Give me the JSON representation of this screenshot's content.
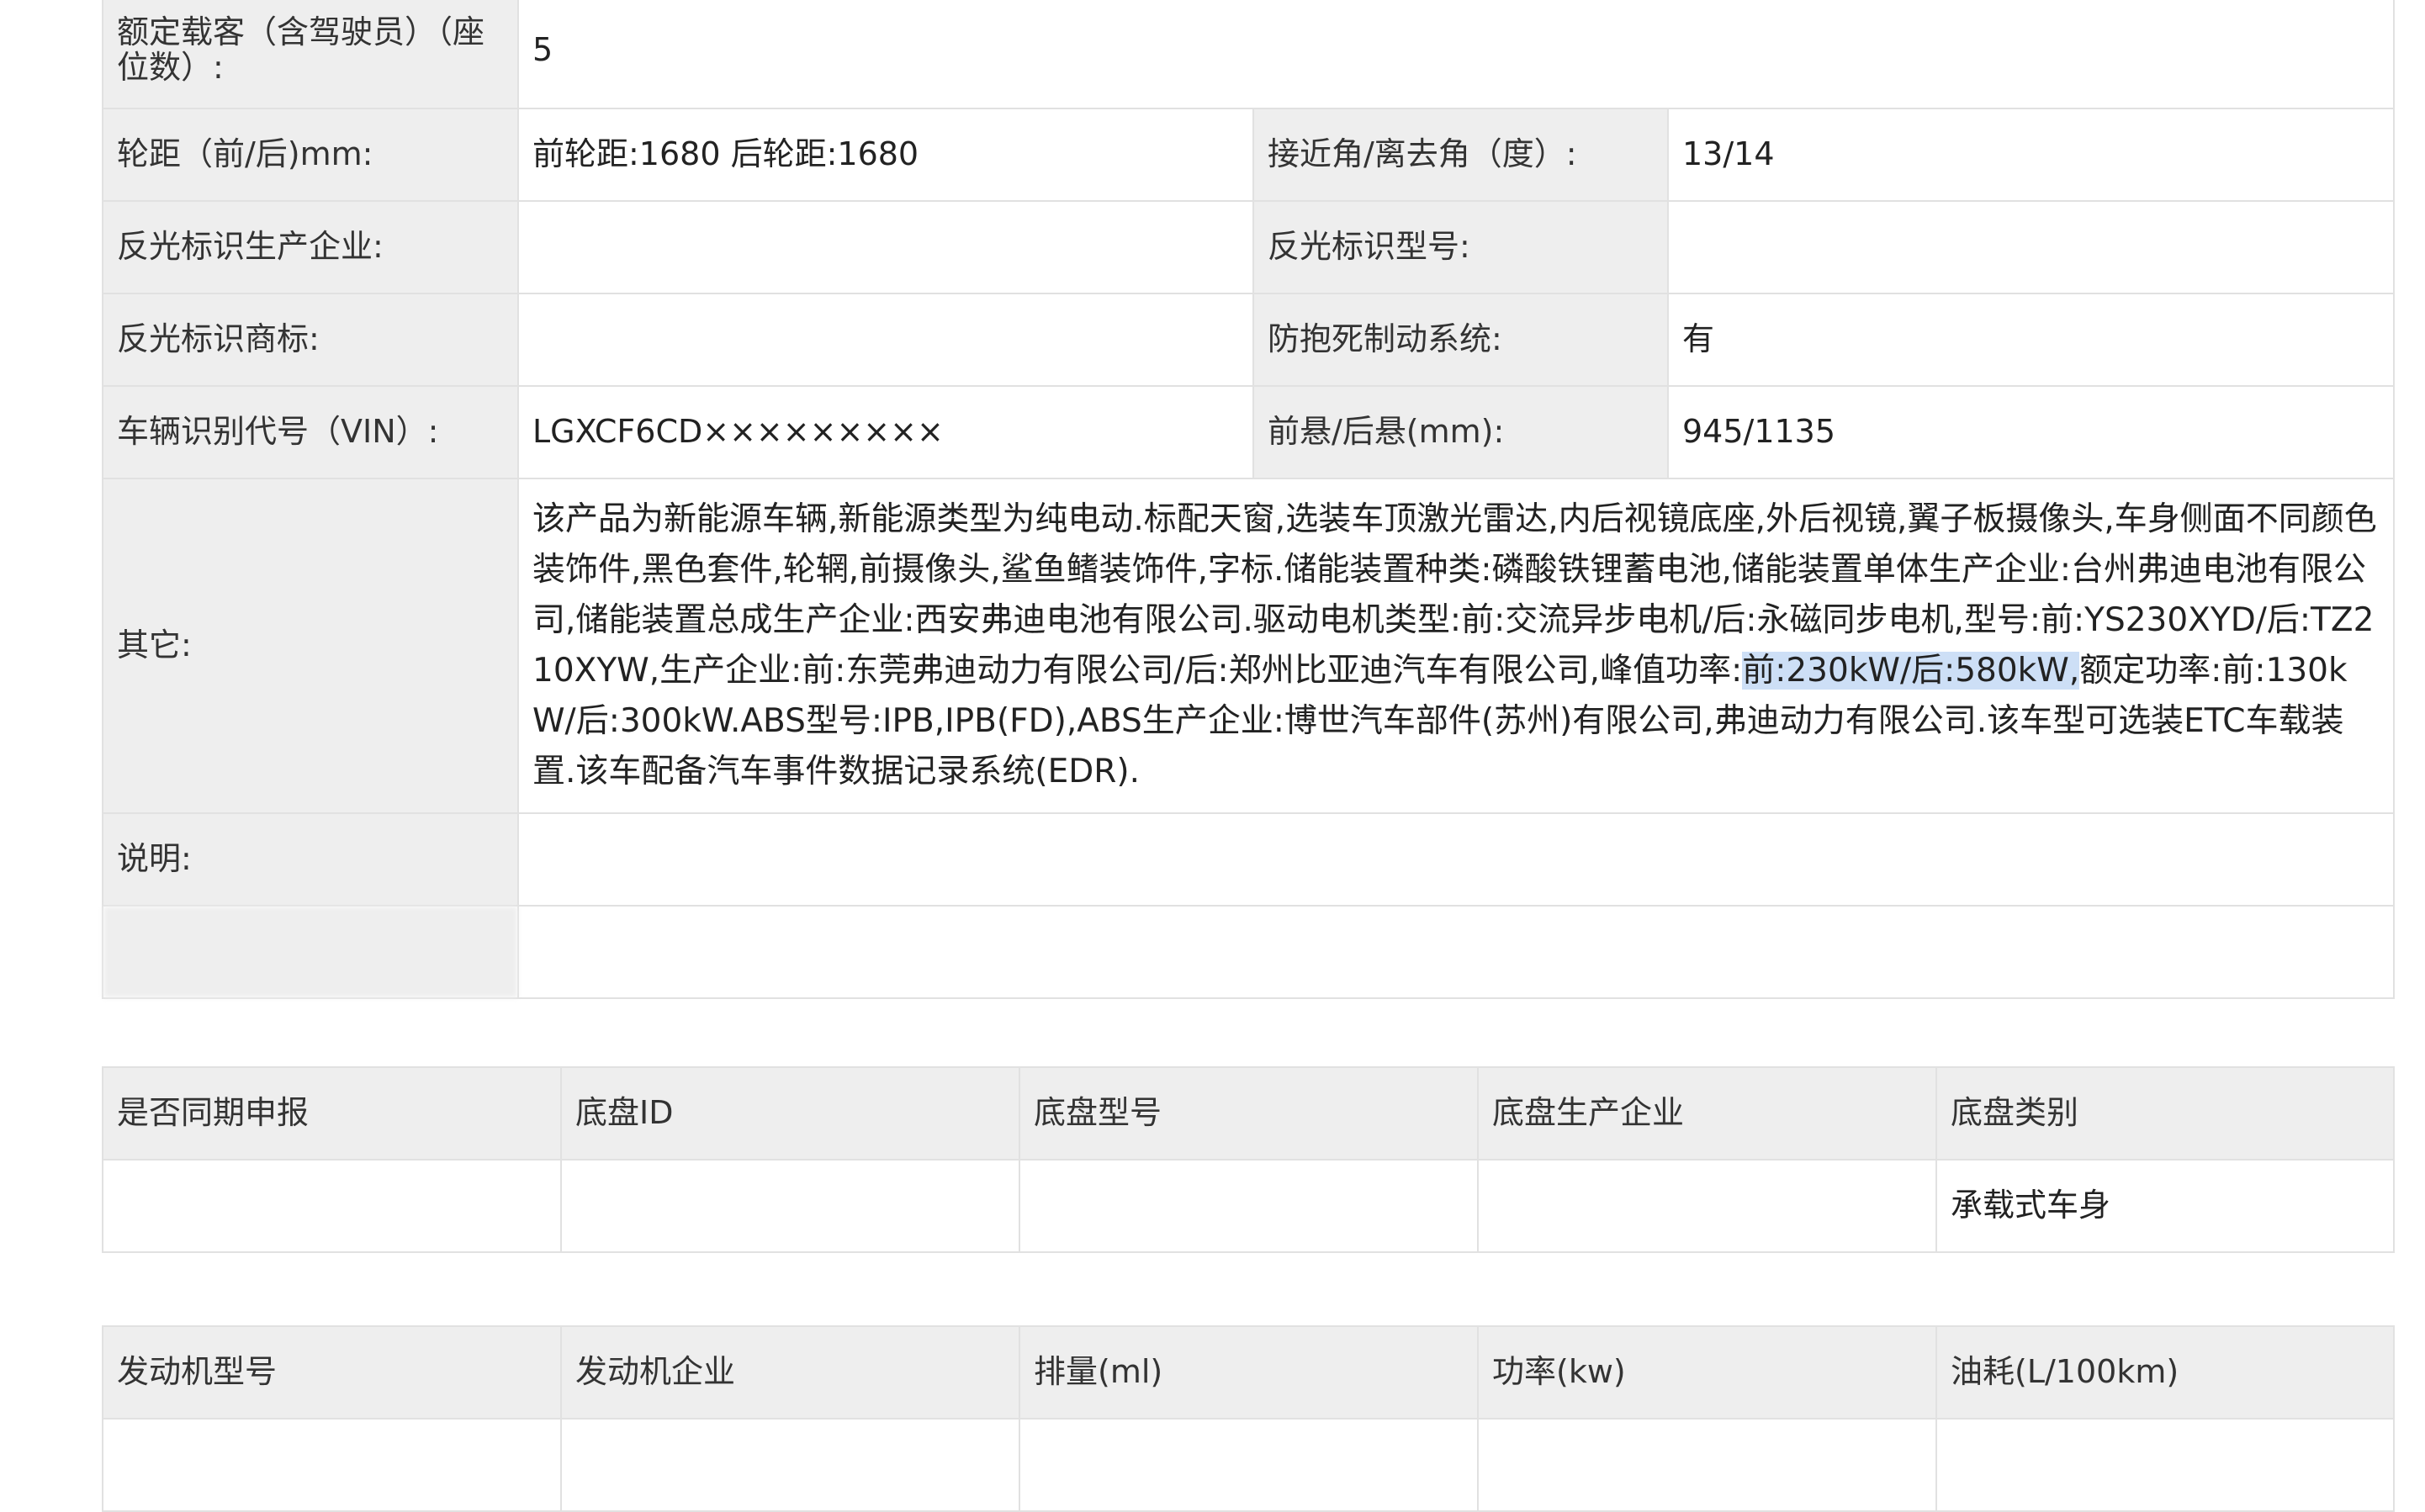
{
  "params": {
    "seats_label": "额定载客（含驾驶员）（座位数）:",
    "seats_value": "5",
    "track_label": "轮距（前/后)mm:",
    "track_value": "前轮距:1680 后轮距:1680",
    "angle_label": "接近角/离去角（度）:",
    "angle_value": "13/14",
    "reflector_maker_label": "反光标识生产企业:",
    "reflector_maker_value": "",
    "reflector_model_label": "反光标识型号:",
    "reflector_model_value": "",
    "reflector_brand_label": "反光标识商标:",
    "reflector_brand_value": "",
    "abs_label": "防抱死制动系统:",
    "abs_value": "有",
    "vin_label": "车辆识别代号（VIN）:",
    "vin_value": "LGXCF6CD×××××××××",
    "overhang_label": "前悬/后悬(mm):",
    "overhang_value": "945/1135",
    "other_label": "其它:",
    "other_text_before": "该产品为新能源车辆,新能源类型为纯电动.标配天窗,选装车顶激光雷达,内后视镜底座,外后视镜,翼子板摄像头,车身侧面不同颜色装饰件,黑色套件,轮辋,前摄像头,鲨鱼鳍装饰件,字标.储能装置种类:磷酸铁锂蓄电池,储能装置单体生产企业:台州弗迪电池有限公司,储能装置总成生产企业:西安弗迪电池有限公司.驱动电机类型:前:交流异步电机/后:永磁同步电机,型号:前:YS230XYD/后:TZ210XYW,生产企业:前:东莞弗迪动力有限公司/后:郑州比亚迪汽车有限公司,峰值功率:",
    "other_text_highlight": "前:230kW/后:580kW,",
    "other_text_after": "额定功率:前:130kW/后:300kW.ABS型号:IPB,IPB(FD),ABS生产企业:博世汽车部件(苏州)有限公司,弗迪动力有限公司.该车型可选装ETC车载装置.该车配备汽车事件数据记录系统(EDR).",
    "remark_label": "说明:",
    "remark_value": "",
    "blurred_label": "",
    "blurred_value": ""
  },
  "chassis": {
    "headers": [
      "是否同期申报",
      "底盘ID",
      "底盘型号",
      "底盘生产企业",
      "底盘类别"
    ],
    "rows": [
      [
        "",
        "",
        "",
        "",
        "承载式车身"
      ]
    ]
  },
  "engine": {
    "headers": [
      "发动机型号",
      "发动机企业",
      "排量(ml)",
      "功率(kw)",
      "油耗(L/100km)"
    ],
    "rows": [
      [
        "",
        "",
        "",
        "",
        ""
      ]
    ]
  }
}
